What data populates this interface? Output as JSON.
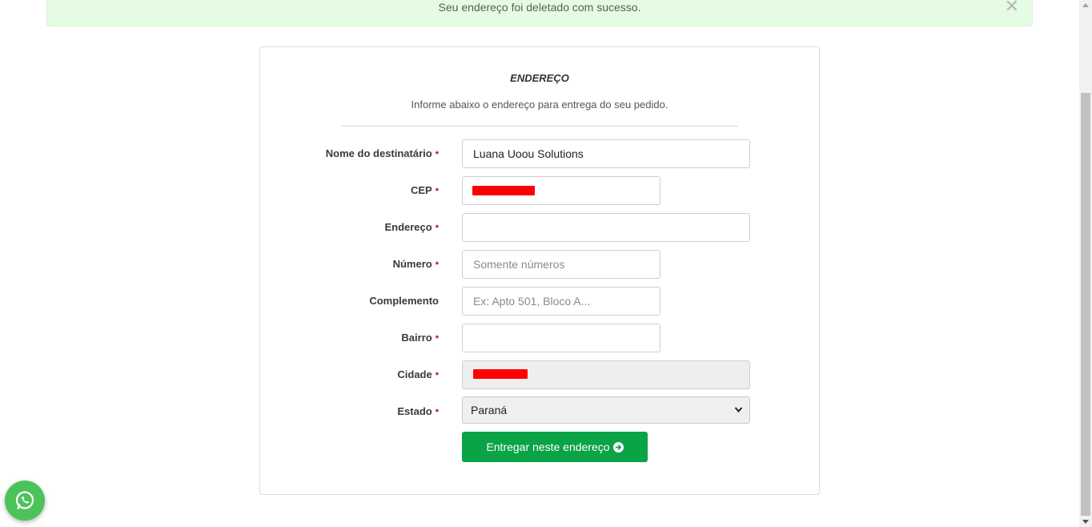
{
  "alert": {
    "message": "Seu endereço foi deletado com sucesso.",
    "close_glyph": "✕"
  },
  "form": {
    "title": "ENDEREÇO",
    "subtitle": "Informe abaixo o endereço para entrega do seu pedido.",
    "required_mark": "*",
    "fields": {
      "nome": {
        "label": "Nome do destinatário",
        "value": "Luana Uoou Solutions",
        "placeholder": ""
      },
      "cep": {
        "label": "CEP",
        "value": "",
        "placeholder": ""
      },
      "endereco": {
        "label": "Endereço",
        "value": "",
        "placeholder": ""
      },
      "numero": {
        "label": "Número",
        "value": "",
        "placeholder": "Somente números"
      },
      "complemento": {
        "label": "Complemento",
        "value": "",
        "placeholder": "Ex: Apto 501, Bloco A..."
      },
      "bairro": {
        "label": "Bairro",
        "value": "",
        "placeholder": ""
      },
      "cidade": {
        "label": "Cidade",
        "value": ""
      },
      "estado": {
        "label": "Estado",
        "selected": "Paraná"
      }
    },
    "submit_label": "Entregar neste endereço"
  },
  "colors": {
    "accent_green": "#0aa345",
    "required_red": "#d0021b",
    "alert_bg": "#e6fbe3",
    "whatsapp_green": "#4cc35a"
  }
}
